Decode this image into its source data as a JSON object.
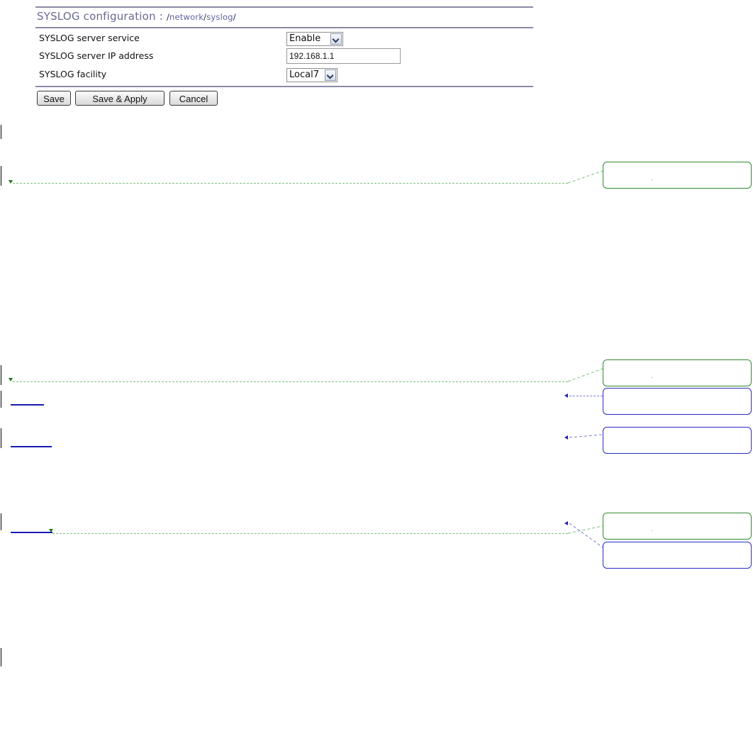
{
  "panel": {
    "title": "SYSLOG configuration",
    "title_separator": " : ",
    "path": [
      "/",
      "network",
      "/",
      "syslog",
      "/"
    ],
    "rows": [
      {
        "label": "SYSLOG server service",
        "control": "select",
        "value": "Enable"
      },
      {
        "label": "SYSLOG server IP address",
        "control": "text",
        "value": "192.168.1.1"
      },
      {
        "label": "SYSLOG facility",
        "control": "select",
        "value": "Local7"
      }
    ],
    "buttons": {
      "save": "Save",
      "save_apply": "Save & Apply",
      "cancel": "Cancel"
    }
  },
  "colors": {
    "rule": "#8a8aa8",
    "title": "#6a6a90",
    "insertion_marker": "#2e8b2e",
    "link_marker": "#2a2ac8"
  },
  "overlay": {
    "insertion_balloons": 3,
    "link_balloons": 3
  }
}
